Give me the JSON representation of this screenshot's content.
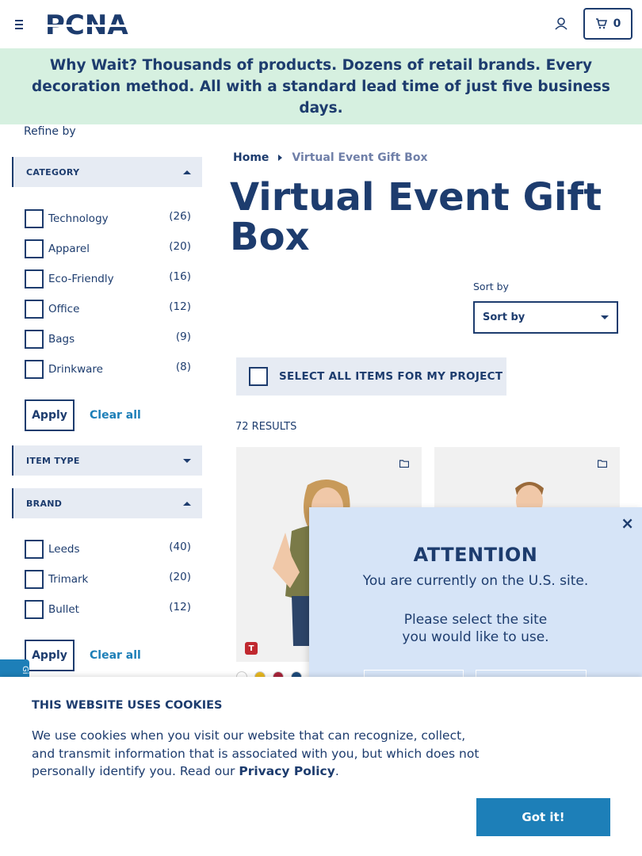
{
  "header": {
    "logo_text": "PCNA",
    "cart_count": "0"
  },
  "banner": {
    "text": "Why Wait? Thousands of products. Dozens of retail brands. Every decoration method. All with a standard lead time of just five business days."
  },
  "sidebar": {
    "refine_by": "Refine by",
    "category": {
      "title": "CATEGORY",
      "items": [
        {
          "label": "Technology",
          "count": "(26)"
        },
        {
          "label": "Apparel",
          "count": "(20)"
        },
        {
          "label": "Eco-Friendly",
          "count": "(16)"
        },
        {
          "label": "Office",
          "count": "(12)"
        },
        {
          "label": "Bags",
          "count": "(9)"
        },
        {
          "label": "Drinkware",
          "count": "(8)"
        }
      ],
      "apply": "Apply",
      "clear": "Clear all"
    },
    "item_type": {
      "title": "ITEM TYPE"
    },
    "brand": {
      "title": "BRAND",
      "items": [
        {
          "label": "Leeds",
          "count": "(40)"
        },
        {
          "label": "Trimark",
          "count": "(20)"
        },
        {
          "label": "Bullet",
          "count": "(12)"
        }
      ],
      "apply": "Apply",
      "clear": "Clear all"
    }
  },
  "main": {
    "breadcrumb": {
      "home": "Home",
      "current": "Virtual Event Gift Box"
    },
    "title": "Virtual Event Gift Box",
    "sort_label": "Sort by",
    "sort_value": "Sort by",
    "select_all": "SELECT ALL ITEMS FOR MY PROJECT",
    "results": "72 RESULTS",
    "brand_badge": "T",
    "swatch_colors": [
      "#ffffff",
      "#e8b81f",
      "#a8243a",
      "#1d4a7a"
    ]
  },
  "modal": {
    "close": "×",
    "heading": "ATTENTION",
    "line1": "You are currently on the U.S. site.",
    "line2": "Please select the site you would like to use."
  },
  "side_tab": "Gi",
  "cookie": {
    "heading": "THIS WEBSITE USES COOKIES",
    "body": "We use cookies when you visit our website that can recognize, collect, and transmit information that is associated with you, but which does not personally identify you. Read our",
    "link": "Privacy Policy",
    "period": ".",
    "button": "Got it!"
  }
}
